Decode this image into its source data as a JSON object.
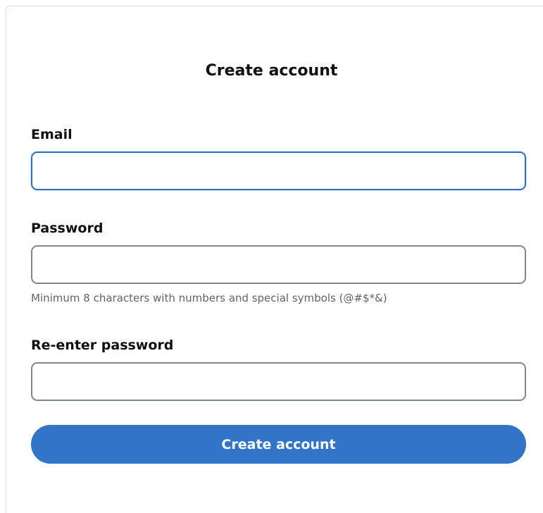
{
  "form": {
    "title": "Create account",
    "email": {
      "label": "Email",
      "value": "",
      "placeholder": ""
    },
    "password": {
      "label": "Password",
      "value": "",
      "placeholder": "",
      "hint": "Minimum 8 characters with numbers and special symbols (@#$*&)"
    },
    "confirm_password": {
      "label": "Re-enter password",
      "value": "",
      "placeholder": ""
    },
    "submit_label": "Create account"
  },
  "colors": {
    "accent": "#3174c8",
    "focus_border": "#2f6ec5",
    "input_border": "#80868f",
    "hint_text": "#5f6368"
  }
}
